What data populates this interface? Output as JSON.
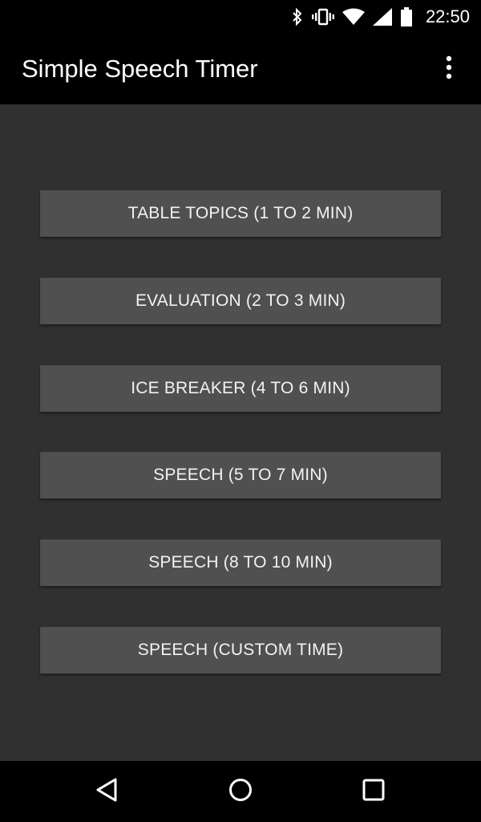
{
  "status_bar": {
    "time": "22:50",
    "icons": [
      "bluetooth-icon",
      "vibrate-icon",
      "wifi-icon",
      "cell-signal-icon",
      "battery-icon"
    ]
  },
  "app_bar": {
    "title": "Simple Speech Timer",
    "menu_icon": "overflow-menu-icon"
  },
  "buttons": [
    {
      "label": "TABLE TOPICS (1 TO 2 MIN)"
    },
    {
      "label": "EVALUATION (2 TO 3 MIN)"
    },
    {
      "label": "ICE BREAKER (4 TO 6 MIN)"
    },
    {
      "label": "SPEECH (5 TO 7 MIN)"
    },
    {
      "label": "SPEECH (8 TO 10 MIN)"
    },
    {
      "label": "SPEECH (CUSTOM TIME)"
    }
  ],
  "nav_bar": {
    "icons": [
      "back-icon",
      "home-icon",
      "recents-icon"
    ]
  },
  "colors": {
    "background": "#303030",
    "bars": "#000000",
    "button": "#505050",
    "text": "#f2f2f2"
  }
}
